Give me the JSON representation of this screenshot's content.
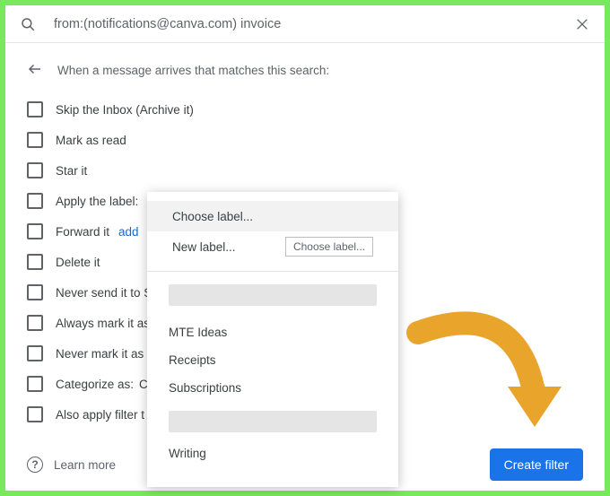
{
  "search": {
    "value": "from:(notifications@canva.com) invoice"
  },
  "heading": "When a message arrives that matches this search:",
  "options": {
    "skip_inbox": "Skip the Inbox (Archive it)",
    "mark_read": "Mark as read",
    "star_it": "Star it",
    "apply_label": "Apply the label:",
    "forward_it": "Forward it",
    "forward_add": "add",
    "delete_it": "Delete it",
    "never_spam": "Never send it to S",
    "always_important": "Always mark it as",
    "never_important": "Never mark it as",
    "categorize": "Categorize as:",
    "categorize_extra": "C",
    "also_apply": "Also apply filter t"
  },
  "dropdown": {
    "choose_label": "Choose label...",
    "new_label": "New label...",
    "choose_button": "Choose label...",
    "labels": {
      "mte_ideas": "MTE Ideas",
      "receipts": "Receipts",
      "subscriptions": "Subscriptions",
      "writing": "Writing"
    }
  },
  "footer": {
    "learn_more": "Learn more",
    "create_filter": "Create filter"
  }
}
